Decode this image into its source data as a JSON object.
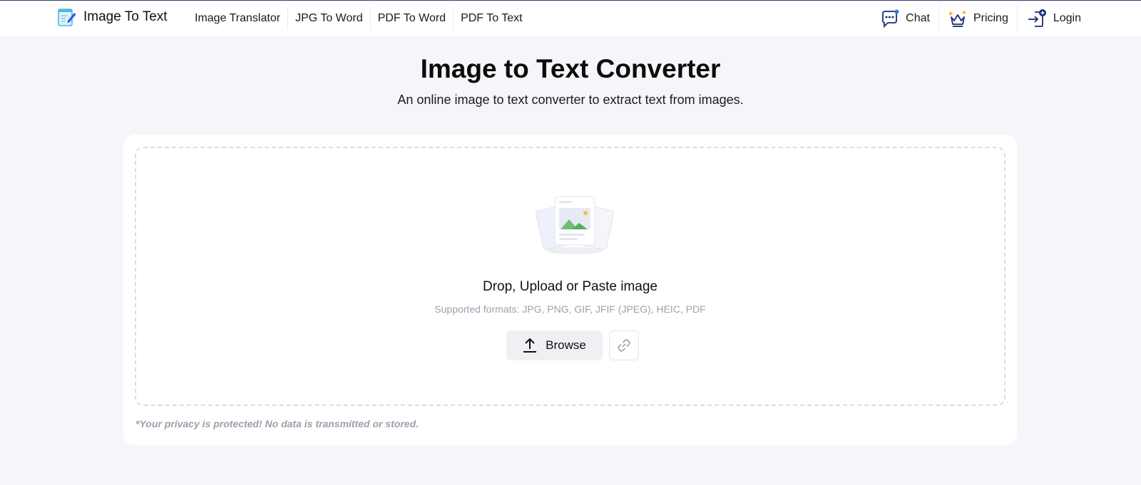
{
  "brand": {
    "name": "Image To Text"
  },
  "nav": {
    "links": [
      "Image Translator",
      "JPG To Word",
      "PDF To Word",
      "PDF To Text"
    ],
    "chat_label": "Chat",
    "pricing_label": "Pricing",
    "login_label": "Login"
  },
  "hero": {
    "title": "Image to Text Converter",
    "subtitle": "An online image to text converter to extract text from images."
  },
  "upload": {
    "drop_title": "Drop, Upload or Paste image",
    "formats": "Supported formats: JPG, PNG, GIF, JFIF (JPEG), HEIC, PDF",
    "browse_label": "Browse",
    "privacy": "*Your privacy is protected! No data is transmitted or stored."
  },
  "icons": {
    "brand": "notepad-pencil-icon",
    "chat": "chat-bubble-icon",
    "pricing": "crown-icon",
    "login": "login-arrow-icon",
    "upload": "upload-arrow-icon",
    "link": "link-icon",
    "illustration": "image-stack-icon"
  },
  "colors": {
    "page_bg": "#f5f6fa",
    "accent": "#2563eb",
    "muted_text": "#9aa1ad",
    "button_bg": "#eef0f4"
  }
}
